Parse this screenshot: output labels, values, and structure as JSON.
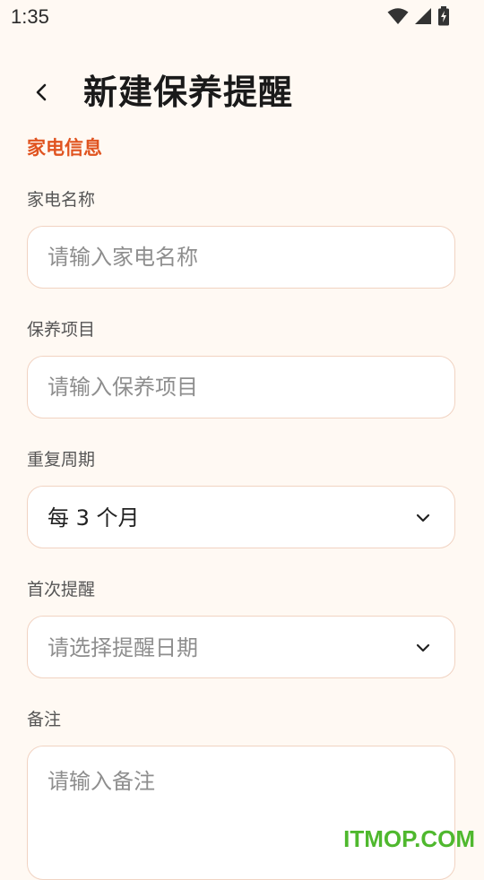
{
  "status_bar": {
    "time": "1:35",
    "icons": [
      "wifi-icon",
      "signal-icon",
      "battery-charging-icon"
    ]
  },
  "header": {
    "back_icon": "chevron-left-icon",
    "title": "新建保养提醒"
  },
  "section": {
    "title": "家电信息"
  },
  "fields": {
    "appliance_name": {
      "label": "家电名称",
      "value": "",
      "placeholder": "请输入家电名称"
    },
    "maintenance_item": {
      "label": "保养项目",
      "value": "",
      "placeholder": "请输入保养项目"
    },
    "repeat_cycle": {
      "label": "重复周期",
      "value": "每 3 个月",
      "icon": "chevron-down-icon"
    },
    "first_reminder": {
      "label": "首次提醒",
      "value": "请选择提醒日期",
      "icon": "chevron-down-icon"
    },
    "notes": {
      "label": "备注",
      "value": "",
      "placeholder": "请输入备注"
    }
  },
  "watermark": "ITMOP.COM",
  "colors": {
    "background": "#FFF9F3",
    "accent": "#E0531F",
    "border": "#F1D3C2",
    "placeholder": "#8E8E8E",
    "watermark": "#4FB82E"
  }
}
